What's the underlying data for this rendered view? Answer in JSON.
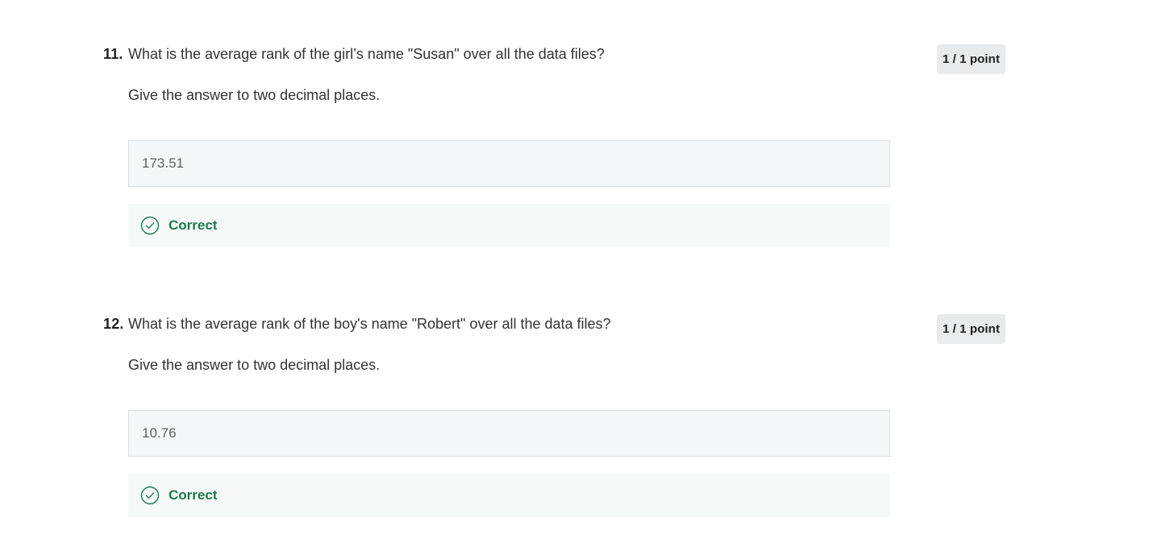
{
  "questions": [
    {
      "number": "11.",
      "text": "What is the average rank of the girl’s name \"Susan\" over all the data files?",
      "instruction": "Give the answer to two decimal places.",
      "points": "1 / 1 point",
      "answer": "173.51",
      "feedback": "Correct",
      "feedback_icon": "check-circle-icon",
      "feedback_color": "#1d7a4c"
    },
    {
      "number": "12.",
      "text": "What is the average rank of the boy's name \"Robert\" over all the data files?",
      "instruction": "Give the answer to two decimal places.",
      "points": "1 / 1 point",
      "answer": "10.76",
      "feedback": "Correct",
      "feedback_icon": "check-circle-icon",
      "feedback_color": "#1d7a4c"
    }
  ]
}
